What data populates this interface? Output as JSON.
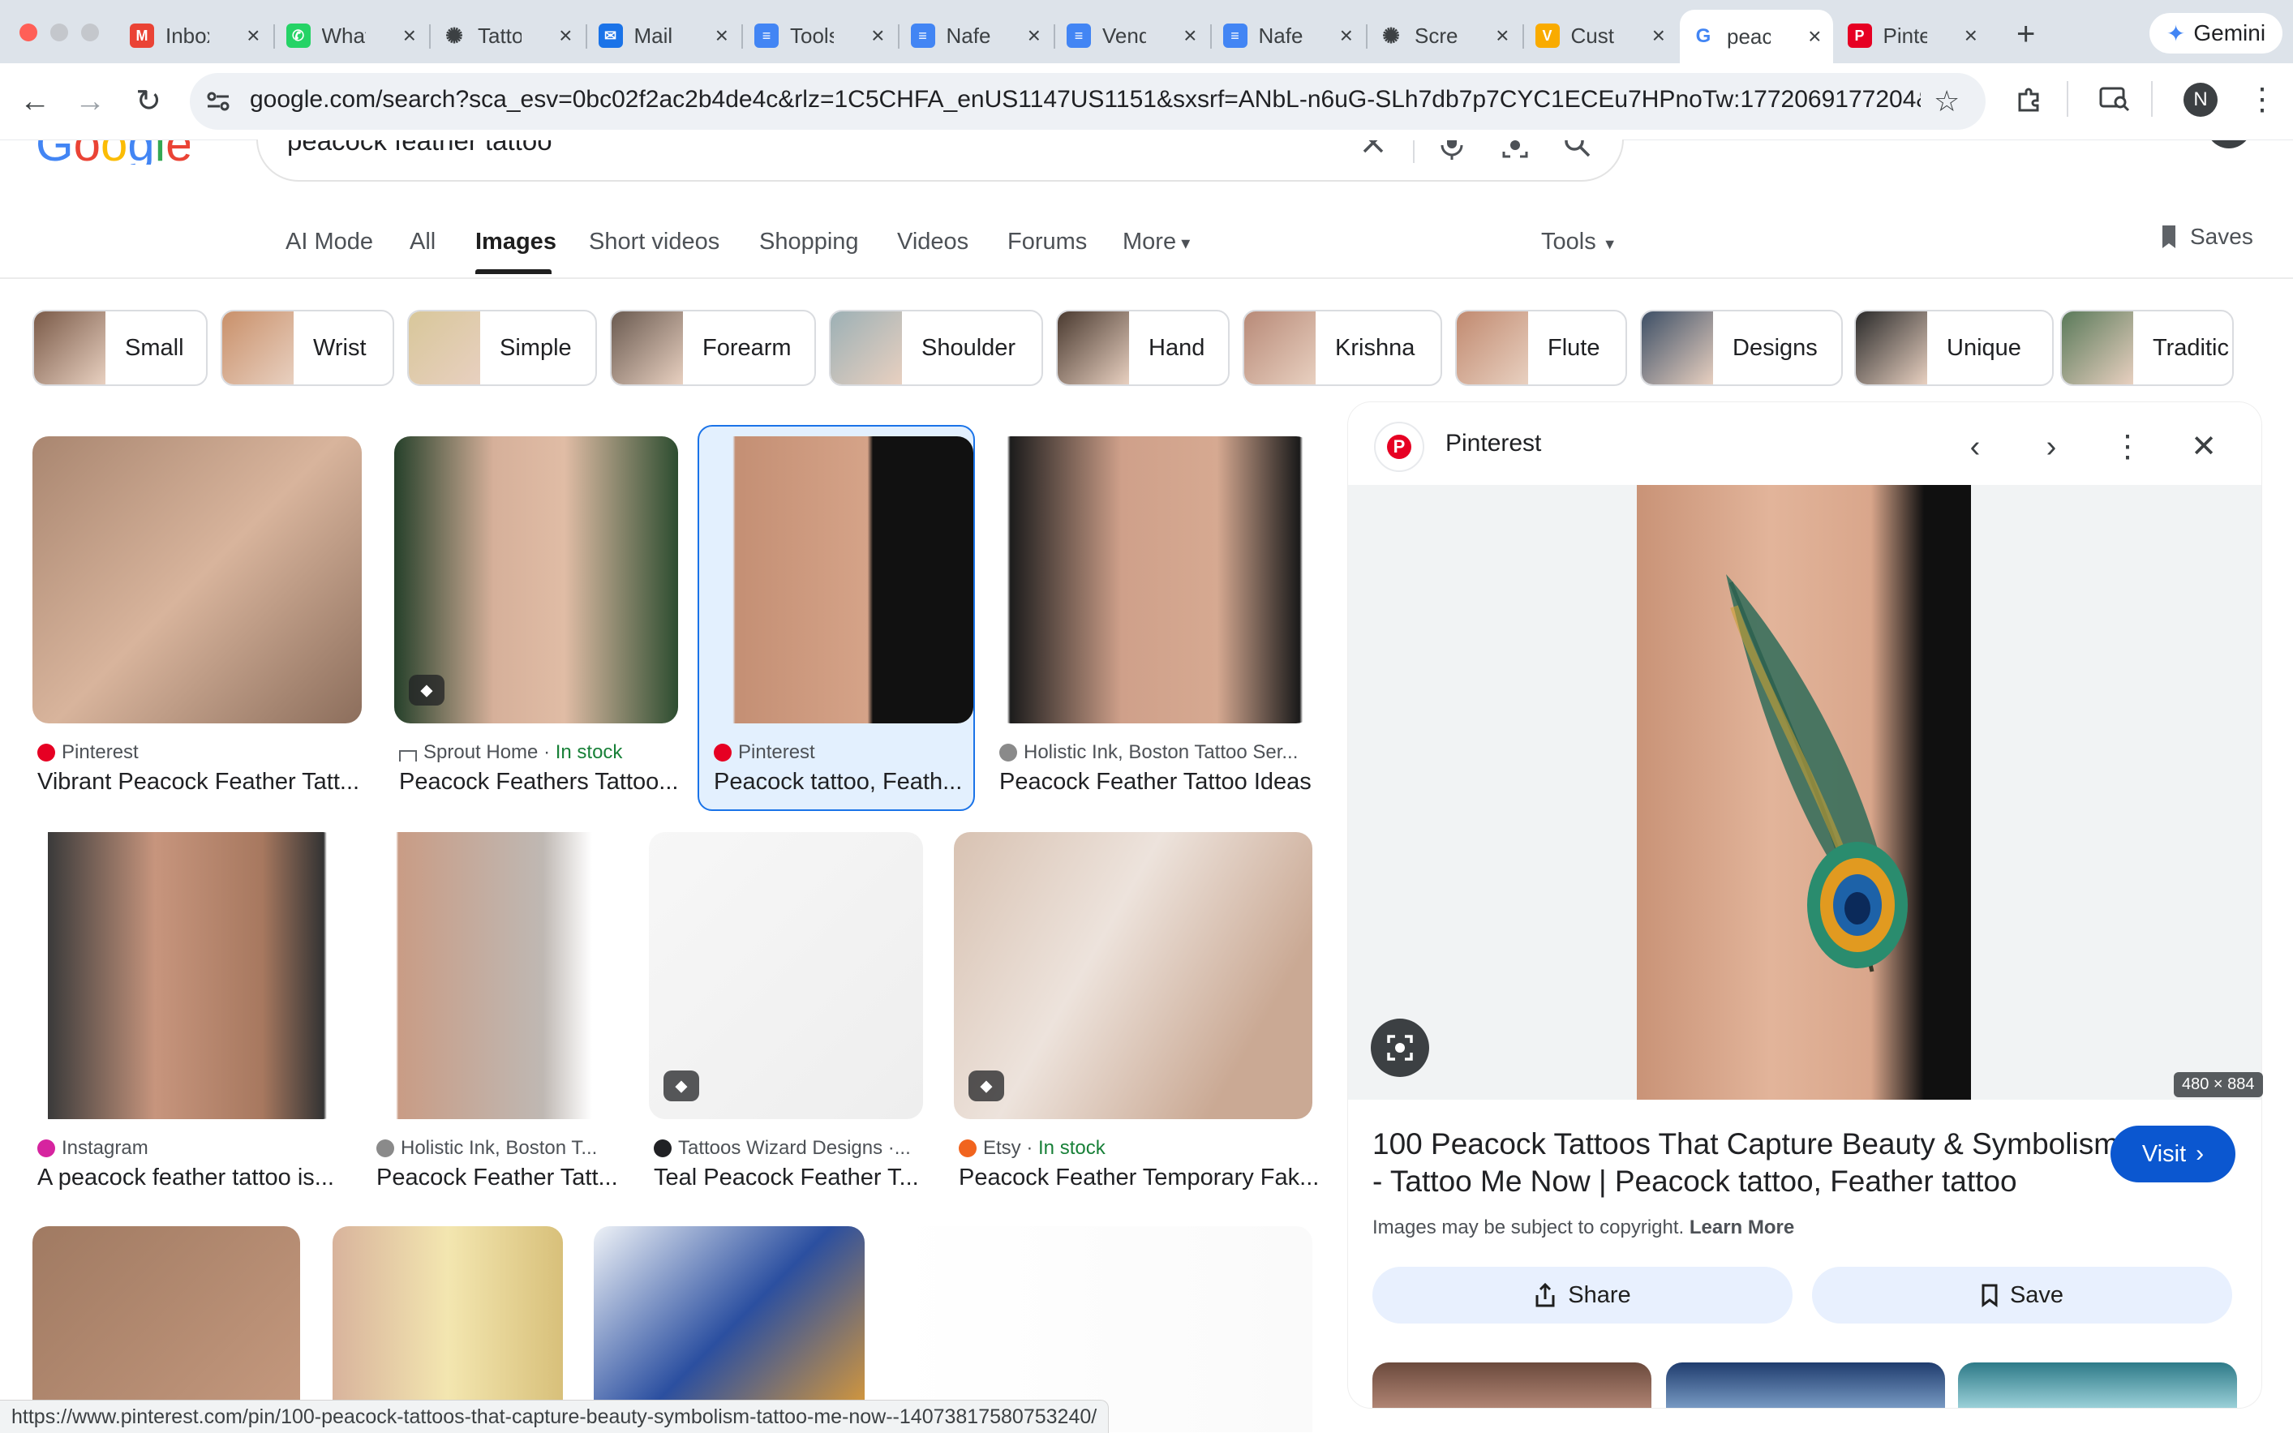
{
  "browser": {
    "tabs": [
      {
        "title": "Inbox",
        "icon": "gmail-icon",
        "color": "#ea4335"
      },
      {
        "title": "WhatsApp",
        "icon": "whatsapp-icon",
        "color": "#25d366"
      },
      {
        "title": "Tattoo",
        "icon": "openai-icon",
        "color": "#3c4043"
      },
      {
        "title": "Mail",
        "icon": "mail-icon",
        "color": "#1a73e8"
      },
      {
        "title": "Tools",
        "icon": "docs-icon",
        "color": "#4285f4"
      },
      {
        "title": "Nafe",
        "icon": "docs-icon",
        "color": "#4285f4"
      },
      {
        "title": "Vend",
        "icon": "docs-icon",
        "color": "#4285f4"
      },
      {
        "title": "Nafe",
        "icon": "docs-icon",
        "color": "#4285f4"
      },
      {
        "title": "Scre",
        "icon": "openai-icon",
        "color": "#3c4043"
      },
      {
        "title": "Cust",
        "icon": "v-icon",
        "color": "#f9ab00"
      },
      {
        "title": "peac",
        "icon": "google-icon",
        "color": "#4285f4",
        "active": true
      },
      {
        "title": "Pinte",
        "icon": "pinterest-icon",
        "color": "#e60023"
      }
    ],
    "new_tab": "+",
    "gemini_label": "Gemini",
    "url": "google.com/search?sca_esv=0bc02f2ac2b4de4c&rlz=1C5CHFA_enUS1147US1151&sxsrf=ANbL-n6uG-SLh7db7p7CYC1ECEu7HPnoTw:1772069177204&ud...",
    "profile_initial": "N",
    "status_url": "https://www.pinterest.com/pin/100-peacock-tattoos-that-capture-beauty-symbolism-tattoo-me-now--14073817580753240/"
  },
  "search": {
    "logo_text": "Google",
    "query": "peacock feather tattoo",
    "nav_tabs": [
      "AI Mode",
      "All",
      "Images",
      "Short videos",
      "Shopping",
      "Videos",
      "Forums",
      "More"
    ],
    "active_tab": "Images",
    "tools_label": "Tools",
    "saves_label": "Saves"
  },
  "chips": [
    "Small",
    "Wrist",
    "Simple",
    "Forearm",
    "Shoulder",
    "Hand",
    "Krishna",
    "Flute",
    "Designs",
    "Unique",
    "Traditic"
  ],
  "results_row1": [
    {
      "source": "Pinterest",
      "title": "Vibrant Peacock Feather Tatt...",
      "stock": ""
    },
    {
      "source": "Sprout Home · ",
      "title": "Peacock Feathers Tattoo...",
      "stock": "In stock"
    },
    {
      "source": "Pinterest",
      "title": "Peacock tattoo, Feath...",
      "stock": ""
    },
    {
      "source": "Holistic Ink, Boston Tattoo Ser...",
      "title": "Peacock Feather Tattoo Ideas",
      "stock": ""
    }
  ],
  "results_row2": [
    {
      "source": "Instagram",
      "title": "A peacock feather tattoo is...",
      "stock": ""
    },
    {
      "source": "Holistic Ink, Boston T...",
      "title": "Peacock Feather Tatt...",
      "stock": ""
    },
    {
      "source": "Tattoos Wizard Designs ·...",
      "title": "Teal Peacock Feather T...",
      "stock": ""
    },
    {
      "source": "Etsy · ",
      "title": "Peacock Feather Temporary Fak...",
      "stock": "In stock"
    }
  ],
  "panel": {
    "source": "Pinterest",
    "dimensions": "480 × 884",
    "title_line1": "100 Peacock Tattoos That Capture Beauty & Symbolism",
    "title_line2": "- Tattoo Me Now | Peacock tattoo, Feather tattoo",
    "visit_label": "Visit",
    "copyright": "Images may be subject to copyright.",
    "learn_more": "Learn More",
    "share_label": "Share",
    "save_label": "Save"
  }
}
